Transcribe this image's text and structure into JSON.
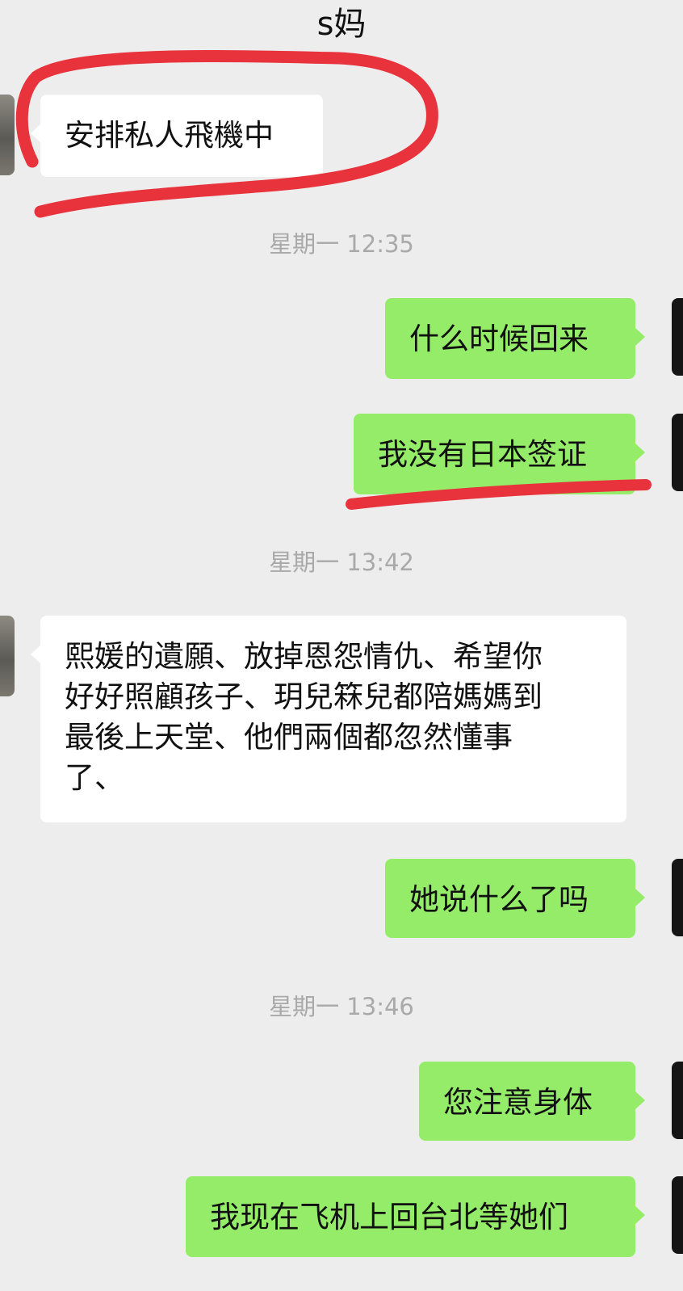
{
  "header": {
    "title": "s妈"
  },
  "messages": [
    {
      "side": "in",
      "text": "安排私人飛機中"
    },
    {
      "side": "out",
      "text": "什么时候回来"
    },
    {
      "side": "out",
      "text": "我没有日本签证"
    },
    {
      "side": "in",
      "text": "熙媛的遺願、放掉恩怨情仇、希望你\n好好照顧孩子、玥兒箖兒都陪媽媽到\n最後上天堂、他們兩個都忽然懂事\n了、"
    },
    {
      "side": "out",
      "text": "她说什么了吗"
    },
    {
      "side": "out",
      "text": "您注意身体"
    },
    {
      "side": "out",
      "text": "我现在飞机上回台北等她们"
    }
  ],
  "timestamps": [
    "星期一 12:35",
    "星期一 13:42",
    "星期一 13:46"
  ],
  "colors": {
    "background": "#ededed",
    "incoming_bubble": "#ffffff",
    "outgoing_bubble": "#95ec69",
    "timestamp_text": "#a9a9a9",
    "annotation_marker": "#e8323c"
  }
}
